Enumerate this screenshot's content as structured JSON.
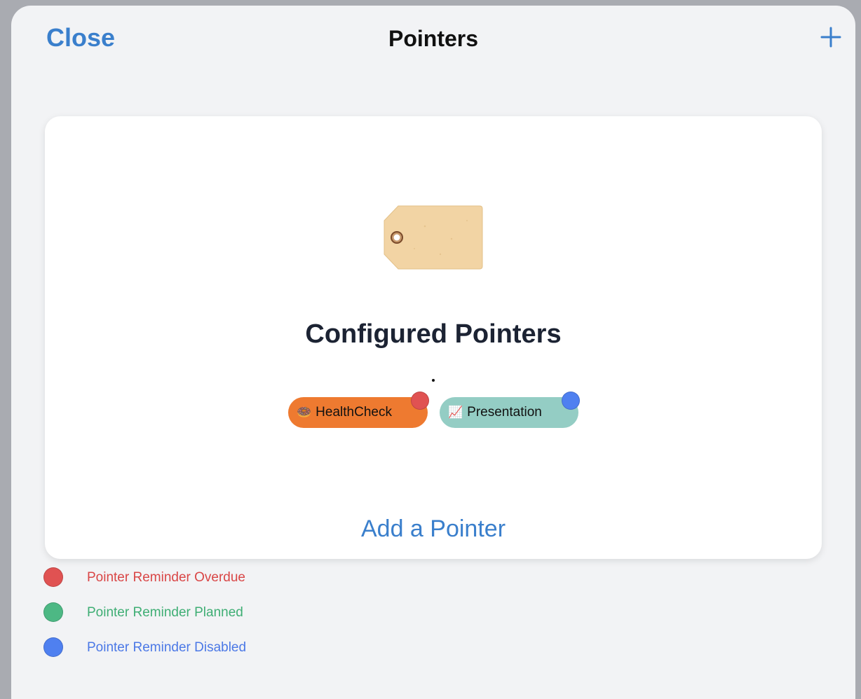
{
  "nav": {
    "close_label": "Close",
    "title": "Pointers",
    "add_icon": "plus-icon",
    "accent_color": "#3a7fcc"
  },
  "card": {
    "illustration_icon": "tag-icon",
    "title": "Configured Pointers",
    "pointers": [
      {
        "emoji": "🍩",
        "label": "HealthCheck",
        "color": "#ee7a30",
        "status": "overdue",
        "status_color": "#e05252"
      },
      {
        "emoji": "📈",
        "label": "Presentation",
        "color": "#94cdc4",
        "status": "disabled",
        "status_color": "#4f80f0"
      }
    ],
    "add_label": "Add a Pointer"
  },
  "legend": [
    {
      "label": "Pointer Reminder Overdue",
      "color": "#e05252"
    },
    {
      "label": "Pointer Reminder Planned",
      "color": "#4db884"
    },
    {
      "label": "Pointer Reminder Disabled",
      "color": "#4f80f0"
    }
  ]
}
